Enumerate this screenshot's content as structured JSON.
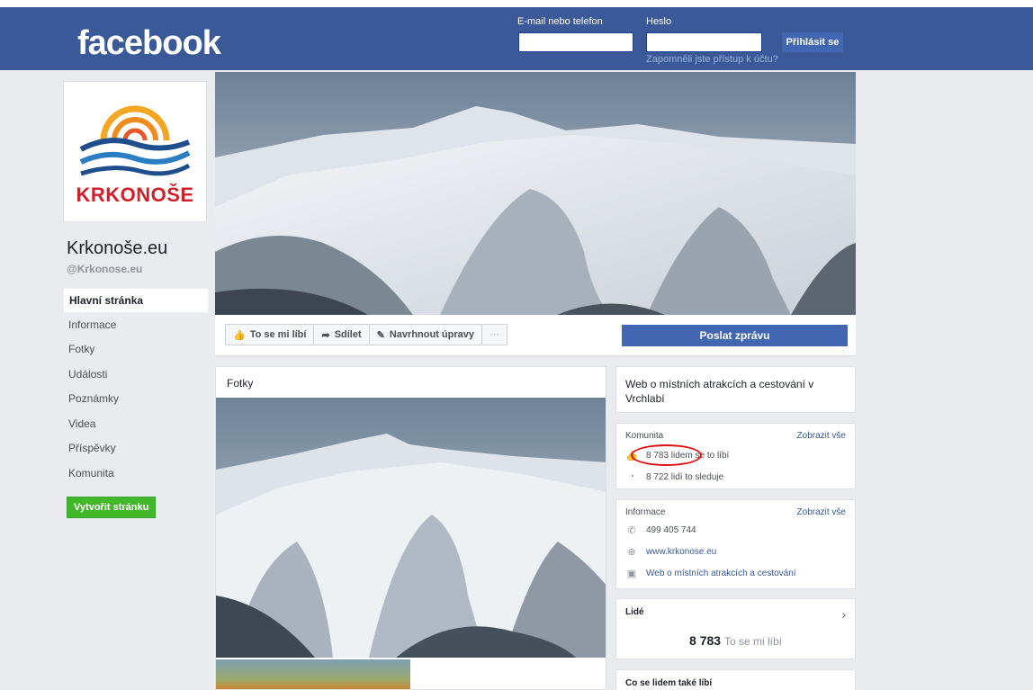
{
  "header": {
    "logo": "facebook",
    "email_label": "E-mail nebo telefon",
    "password_label": "Heslo",
    "email_value": "",
    "password_value": "",
    "login_button": "Přihlásit se",
    "forgot_link": "Zapomněli jste přístup k účtu?"
  },
  "sidebar": {
    "logo_text": "KRKONOŠE",
    "page_name": "Krkonoše.eu",
    "page_handle": "@Krkonose.eu",
    "items": [
      {
        "label": "Hlavní stránka"
      },
      {
        "label": "Informace"
      },
      {
        "label": "Fotky"
      },
      {
        "label": "Události"
      },
      {
        "label": "Poznámky"
      },
      {
        "label": "Videa"
      },
      {
        "label": "Příspěvky"
      },
      {
        "label": "Komunita"
      }
    ],
    "create_page": "Vytvořit stránku"
  },
  "actions": {
    "like": "To se mi líbí",
    "share": "Sdílet",
    "suggest_edits": "Navrhnout úpravy",
    "more": "···",
    "message": "Poslat zprávu"
  },
  "photos": {
    "title": "Fotky"
  },
  "about": {
    "description": "Web o místních atrakcích a cestování v Vrchlabí"
  },
  "community": {
    "title": "Komunita",
    "see_all": "Zobrazit vše",
    "likes_highlighted": "8 783 lidem",
    "likes_rest": "se to líbí",
    "followers": "8 722 lidí to sleduje"
  },
  "info": {
    "title": "Informace",
    "see_all": "Zobrazit vše",
    "phone": "499 405 744",
    "website": "www.krkonose.eu",
    "category": "Web o místních atrakcích a cestování"
  },
  "people": {
    "title": "Lidé",
    "count": "8 783",
    "count_label": "To se mi líbí"
  },
  "also_like": {
    "title": "Co se lidem také líbí"
  },
  "colors": {
    "brand_blue": "#3b5998",
    "button_blue": "#4267b2",
    "green": "#42b72a",
    "highlight_red": "#dd1111"
  }
}
